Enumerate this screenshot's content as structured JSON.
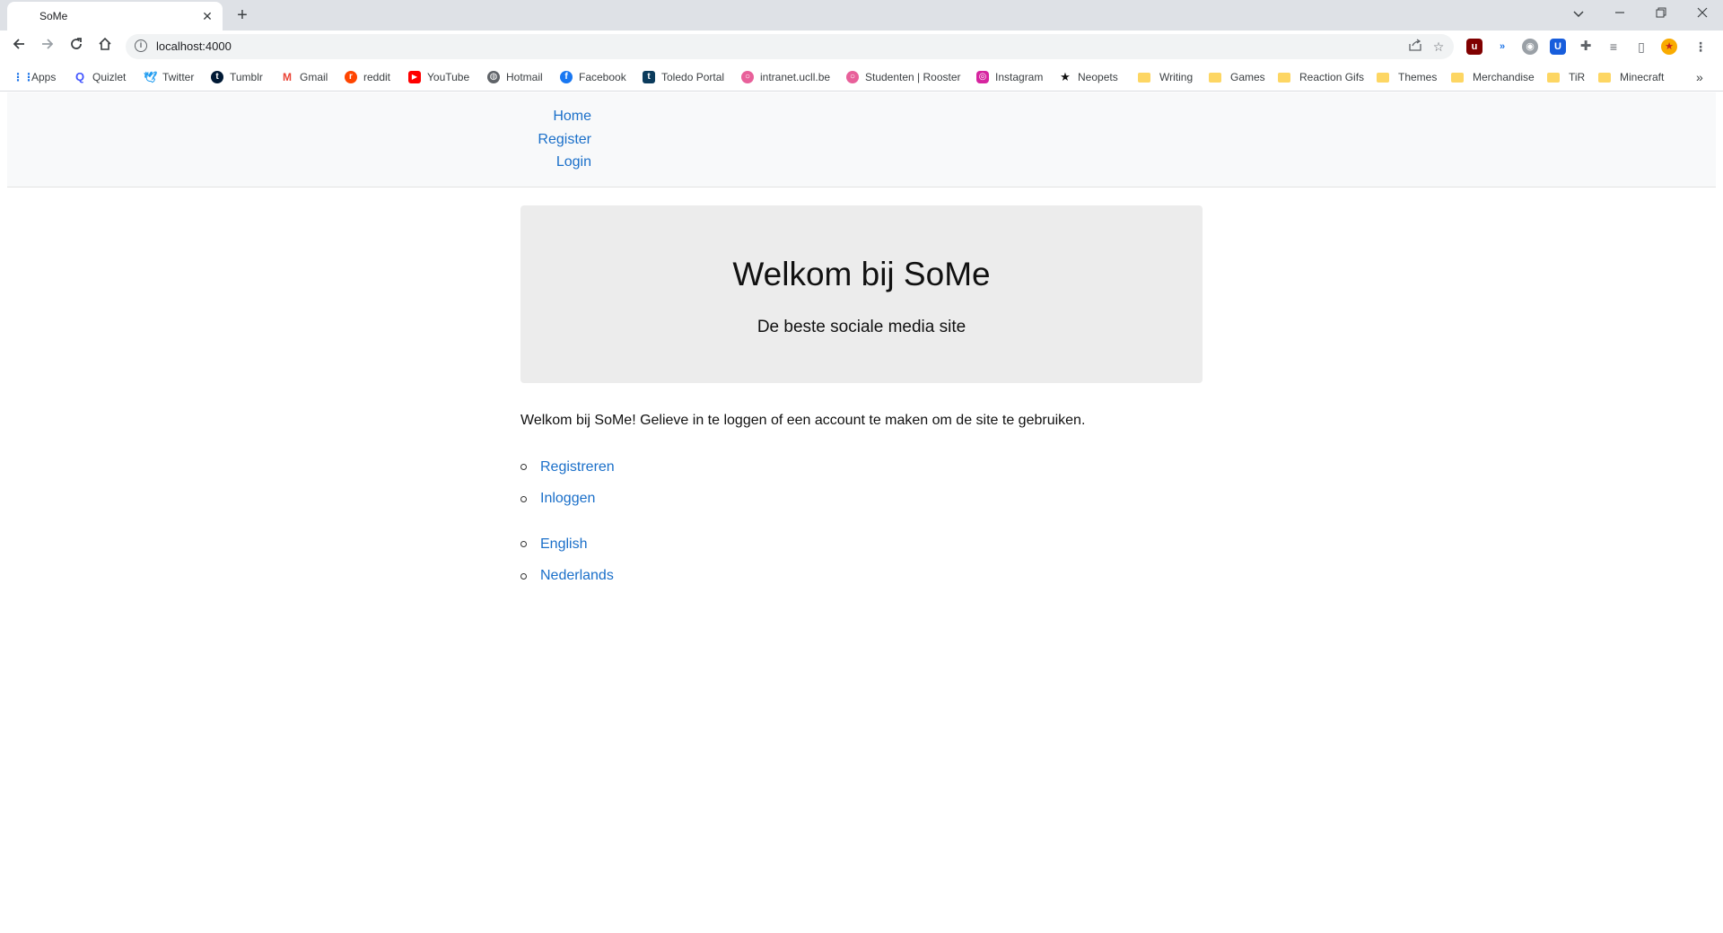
{
  "browser": {
    "tab_title": "SoMe",
    "tab_close": "✕",
    "new_tab": "+",
    "url": "localhost:4000",
    "bookmarks": [
      {
        "label": "Apps",
        "icon": "apps-grid-icon"
      },
      {
        "label": "Quizlet",
        "icon": "quizlet-icon"
      },
      {
        "label": "Twitter",
        "icon": "twitter-icon"
      },
      {
        "label": "Tumblr",
        "icon": "tumblr-icon"
      },
      {
        "label": "Gmail",
        "icon": "gmail-icon"
      },
      {
        "label": "reddit",
        "icon": "reddit-icon"
      },
      {
        "label": "YouTube",
        "icon": "youtube-icon"
      },
      {
        "label": "Hotmail",
        "icon": "globe-icon"
      },
      {
        "label": "Facebook",
        "icon": "facebook-icon"
      },
      {
        "label": "Toledo Portal",
        "icon": "toledo-icon"
      },
      {
        "label": "intranet.ucll.be",
        "icon": "ucll-icon"
      },
      {
        "label": "Studenten | Rooster",
        "icon": "ucll-icon"
      },
      {
        "label": "Instagram",
        "icon": "instagram-icon"
      },
      {
        "label": "Neopets",
        "icon": "star-icon"
      },
      {
        "label": "Writing",
        "icon": "folder-icon"
      },
      {
        "label": "Games",
        "icon": "folder-icon"
      },
      {
        "label": "Reaction Gifs",
        "icon": "folder-icon"
      },
      {
        "label": "Themes",
        "icon": "folder-icon"
      },
      {
        "label": "Merchandise",
        "icon": "folder-icon"
      },
      {
        "label": "TiR",
        "icon": "folder-icon"
      },
      {
        "label": "Minecraft",
        "icon": "folder-icon"
      }
    ],
    "more_bookmarks": "»"
  },
  "nav": {
    "items": [
      {
        "label": "Home"
      },
      {
        "label": "Register"
      },
      {
        "label": "Login"
      }
    ]
  },
  "hero": {
    "title": "Welkom bij SoMe",
    "subtitle": "De beste sociale media site"
  },
  "main": {
    "intro": "Welkom bij SoMe! Gelieve in te loggen of een account te maken om de site te gebruiken.",
    "auth_links": [
      {
        "label": "Registreren"
      },
      {
        "label": "Inloggen"
      }
    ],
    "language_links": [
      {
        "label": "English"
      },
      {
        "label": "Nederlands"
      }
    ]
  },
  "colors": {
    "link": "#1a6fc9",
    "nav_bg": "#f8f9fa",
    "hero_bg": "#ececec",
    "chrome_tabbar": "#dee1e6"
  }
}
